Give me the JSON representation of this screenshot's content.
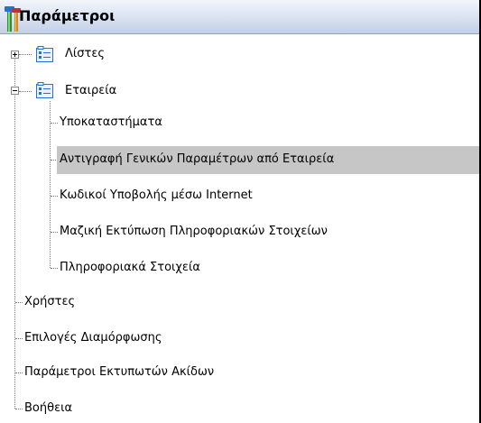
{
  "window": {
    "title": "Παράμετροι"
  },
  "tree": {
    "lists": "Λίστες",
    "company": "Εταιρεία",
    "company_children": {
      "branches": "Υποκαταστήματα",
      "copy_params": "Αντιγραφή Γενικών Παραμέτρων από Εταιρεία",
      "internet_codes": "Κωδικοί Υποβολής μέσω Internet",
      "bulk_print": "Μαζική Εκτύπωση Πληροφοριακών Στοιχείων",
      "info": "Πληροφοριακά Στοιχεία"
    },
    "users": "Χρήστες",
    "config_options": "Επιλογές Διαμόρφωσης",
    "dot_printer_params": "Παράμετροι Εκτυπωτών Ακίδων",
    "help": "Βοήθεια"
  },
  "selected_item": "copy_params",
  "colors": {
    "selection": "#c6c6c6",
    "header_gradient_bottom": "#c3cfe6",
    "icon_blue": "#2a6fd6"
  },
  "icons": {
    "header": "tools-icon",
    "folder": "list-folder-icon"
  }
}
